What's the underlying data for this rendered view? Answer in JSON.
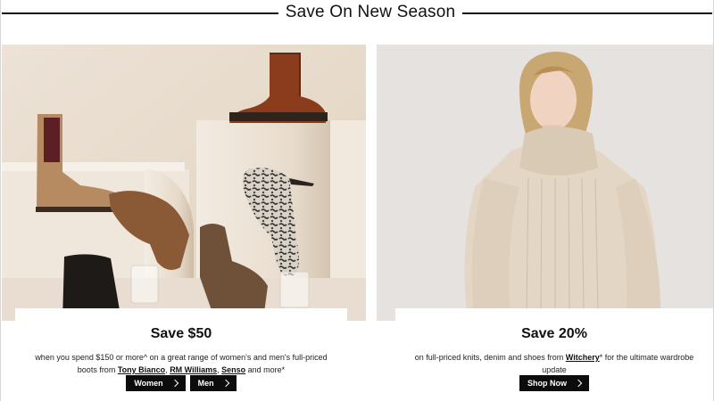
{
  "header": {
    "title": "Save On New Season"
  },
  "left_promo": {
    "heading": "Save $50",
    "desc_before": "when you spend $150 or more^ on a great range of women's and men's full-priced boots from ",
    "brands": [
      "Tony Bianco",
      "RM Williams",
      "Senso"
    ],
    "sep1": ", ",
    "sep2": ", ",
    "desc_after": " and more*",
    "buttons": [
      {
        "label": "Women",
        "icon": "chevron-right-icon"
      },
      {
        "label": "Men",
        "icon": "chevron-right-icon"
      }
    ]
  },
  "right_promo": {
    "heading": "Save 20%",
    "desc_before": "on full-priced knits, denim and shoes from ",
    "brand": "Witchery",
    "desc_after": "* for the ultimate wardrobe update",
    "buttons": [
      {
        "label": "Shop Now",
        "icon": "chevron-right-icon"
      }
    ]
  }
}
